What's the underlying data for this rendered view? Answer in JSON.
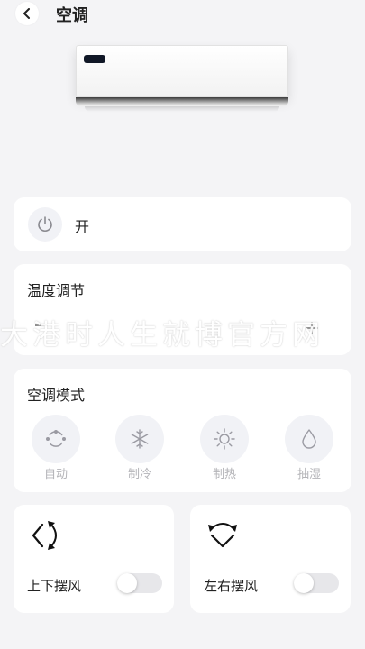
{
  "header": {
    "title": "空调",
    "back_icon": "chevron-left-icon"
  },
  "power": {
    "icon": "power-icon",
    "state": "开"
  },
  "temperature": {
    "label": "温度调节",
    "decrease_icon": "minus-icon",
    "increase_icon": "plus-icon"
  },
  "watermark": {
    "text": "大港时人生就博官方网"
  },
  "mode": {
    "label": "空调模式",
    "items": [
      {
        "label": "自动",
        "icon": "auto-cycle-icon"
      },
      {
        "label": "制冷",
        "icon": "snowflake-icon"
      },
      {
        "label": "制热",
        "icon": "sun-icon"
      },
      {
        "label": "抽湿",
        "icon": "water-drop-icon"
      }
    ]
  },
  "swing": {
    "vertical": {
      "label": "上下摆风",
      "icon": "vertical-swing-icon",
      "on": false
    },
    "horizontal": {
      "label": "左右摆风",
      "icon": "horizontal-swing-icon",
      "on": false
    }
  },
  "colors": {
    "background": "#f4f4f6",
    "card": "#ffffff",
    "icon_bg": "#f1f2f6",
    "muted": "#b4b4b8",
    "toggle_off": "#e7e7ea"
  }
}
